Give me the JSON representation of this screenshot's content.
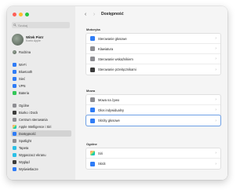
{
  "window": {
    "title": "Dostępność"
  },
  "search": {
    "placeholder": "Szukaj"
  },
  "account": {
    "name": "Witek Piotr",
    "subtitle": "Konto Apple"
  },
  "sidebar": {
    "items": [
      {
        "label": "Rodzina",
        "icon": "family-avatar"
      },
      {
        "label": "Wi-Fi",
        "icon": "wifi-icon",
        "color": "#2f7cf6"
      },
      {
        "label": "Bluetooth",
        "icon": "bluetooth-icon",
        "color": "#2f7cf6"
      },
      {
        "label": "Sieć",
        "icon": "network-icon",
        "color": "#2f7cf6"
      },
      {
        "label": "VPN",
        "icon": "vpn-icon",
        "color": "#2f7cf6"
      },
      {
        "label": "Bateria",
        "icon": "battery-icon",
        "color": "#35c759"
      },
      {
        "label": "Ogólne",
        "icon": "gear-icon",
        "color": "#8e8e93"
      },
      {
        "label": "Biurko i Dock",
        "icon": "dock-icon",
        "color": "#3c3c3c"
      },
      {
        "label": "Centrum sterowania",
        "icon": "control-center-icon",
        "color": "#8e8e93"
      },
      {
        "label": "Apple Intelligence i Siri",
        "icon": "siri-icon",
        "color": "#9b5de5"
      },
      {
        "label": "Dostępność",
        "icon": "accessibility-icon",
        "color": "#2f7cf6",
        "active": true
      },
      {
        "label": "Spotlight",
        "icon": "spotlight-icon",
        "color": "#8e8e93"
      },
      {
        "label": "Tapeta",
        "icon": "wallpaper-icon",
        "color": "#2cc0e6"
      },
      {
        "label": "Wygaszacz ekranu",
        "icon": "screensaver-icon",
        "color": "#2cc0e6"
      },
      {
        "label": "Wygląd",
        "icon": "appearance-icon",
        "color": "#3c3c3c"
      },
      {
        "label": "Wyświetlacze",
        "icon": "display-icon",
        "color": "#2f7cf6"
      }
    ]
  },
  "main": {
    "sections": [
      {
        "header": "Motoryka",
        "rows": [
          {
            "label": "Sterowanie głosowe",
            "icon": "voice-control-icon",
            "color": "#2f7cf6"
          },
          {
            "label": "Klawiatura",
            "icon": "keyboard-icon",
            "color": "#8e8e93"
          },
          {
            "label": "Sterowanie wskaźnikiem",
            "icon": "pointer-icon",
            "color": "#8e8e93"
          },
          {
            "label": "Sterowanie przełącznikami",
            "icon": "switch-control-icon",
            "color": "#3c3c3c"
          }
        ]
      },
      {
        "header": "Mowa",
        "rows": [
          {
            "label": "Mowa na żywo",
            "icon": "live-speech-icon",
            "color": "#8e8e93"
          },
          {
            "label": "Głos indywidualny",
            "icon": "personal-voice-icon",
            "color": "#2f7cf6"
          },
          {
            "label": "Skróty głosowe",
            "icon": "vocal-shortcuts-icon",
            "color": "#2f7cf6",
            "selected": true
          }
        ]
      },
      {
        "header": "Ogólne",
        "rows": [
          {
            "label": "Siri",
            "icon": "siri-icon",
            "color": "#9b5de5"
          },
          {
            "label": "Skrót",
            "icon": "accessibility-shortcut-icon",
            "color": "#2f7cf6"
          }
        ]
      }
    ]
  }
}
